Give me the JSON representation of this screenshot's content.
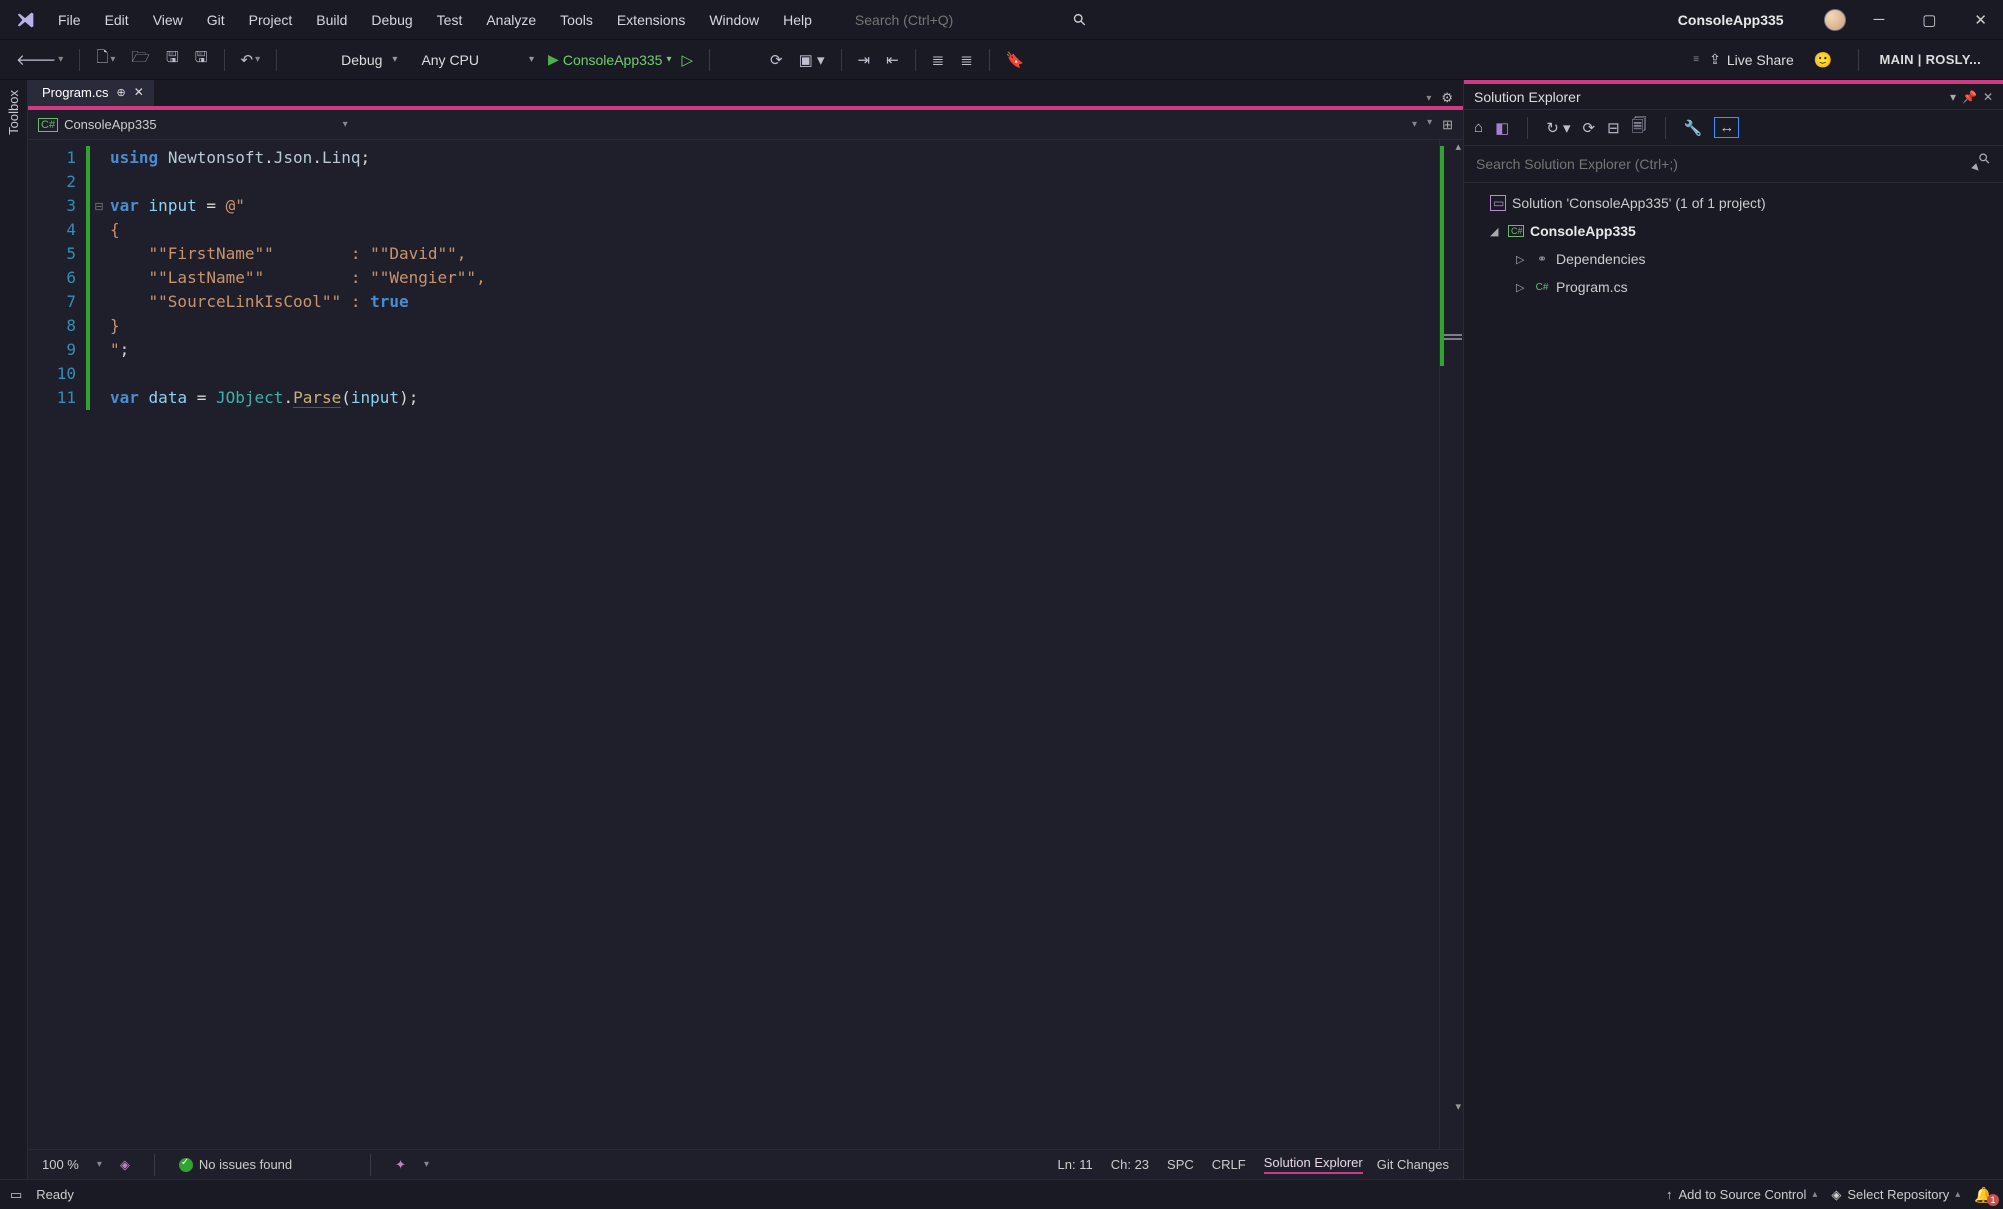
{
  "menus": [
    "File",
    "Edit",
    "View",
    "Git",
    "Project",
    "Build",
    "Debug",
    "Test",
    "Analyze",
    "Tools",
    "Extensions",
    "Window",
    "Help"
  ],
  "search_placeholder": "Search (Ctrl+Q)",
  "app_title": "ConsoleApp335",
  "toolbar": {
    "config": "Debug",
    "platform": "Any CPU",
    "run_target": "ConsoleApp335",
    "live_share": "Live Share",
    "branch": "MAIN | ROSLY..."
  },
  "left_tab": "Toolbox",
  "tabs": {
    "active": "Program.cs"
  },
  "nav_combo": "ConsoleApp335",
  "line_numbers": [
    "1",
    "2",
    "3",
    "4",
    "5",
    "6",
    "7",
    "8",
    "9",
    "10",
    "11"
  ],
  "code": {
    "l1a": "using",
    "l1b": "Newtonsoft",
    "l1c": "Json",
    "l1d": "Linq",
    "l3a": "var",
    "l3b": "input",
    "l3c": "@\"",
    "l4": "{",
    "l5k": "\"\"FirstName\"\"",
    "l5v": "\"\"David\"\"",
    "l6k": "\"\"LastName\"\"",
    "l6v": "\"\"Wengier\"\"",
    "l7k": "\"\"SourceLinkIsCool\"\"",
    "l7v": "true",
    "l8": "}",
    "l9": "\"",
    "l11a": "var",
    "l11b": "data",
    "l11c": "JObject",
    "l11d": "Parse",
    "l11e": "input"
  },
  "editor_status": {
    "zoom": "100 %",
    "issues": "No issues found",
    "ln": "Ln: 11",
    "ch": "Ch: 23",
    "ws": "SPC",
    "le": "CRLF",
    "tab1": "Solution Explorer",
    "tab2": "Git Changes"
  },
  "sol": {
    "title": "Solution Explorer",
    "search_placeholder": "Search Solution Explorer (Ctrl+;)",
    "root": "Solution 'ConsoleApp335' (1 of 1 project)",
    "project": "ConsoleApp335",
    "deps": "Dependencies",
    "file": "Program.cs"
  },
  "statusbar": {
    "ready": "Ready",
    "add_src": "Add to Source Control",
    "sel_repo": "Select Repository"
  }
}
